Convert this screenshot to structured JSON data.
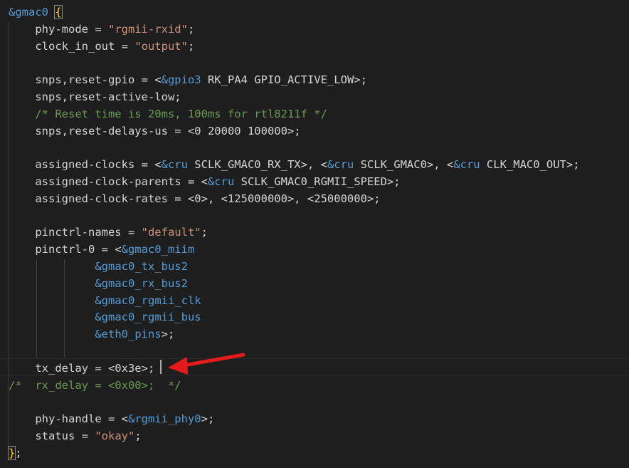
{
  "code": {
    "lines": [
      [
        {
          "t": "&gmac0",
          "c": "ref"
        },
        {
          "t": " ",
          "c": "plain"
        },
        {
          "t": "{",
          "c": "brace"
        }
      ],
      [
        {
          "t": "    phy-mode = ",
          "c": "plain"
        },
        {
          "t": "\"rgmii-rxid\"",
          "c": "str"
        },
        {
          "t": ";",
          "c": "plain"
        }
      ],
      [
        {
          "t": "    clock_in_out = ",
          "c": "plain"
        },
        {
          "t": "\"output\"",
          "c": "str"
        },
        {
          "t": ";",
          "c": "plain"
        }
      ],
      [],
      [
        {
          "t": "    snps,reset-gpio = <",
          "c": "plain"
        },
        {
          "t": "&gpio3",
          "c": "ref"
        },
        {
          "t": " RK_PA4 GPIO_ACTIVE_LOW>;",
          "c": "plain"
        }
      ],
      [
        {
          "t": "    snps,reset-active-low;",
          "c": "plain"
        }
      ],
      [
        {
          "t": "    /* Reset time is 20ms, 100ms for rtl8211f */",
          "c": "comment"
        }
      ],
      [
        {
          "t": "    snps,reset-delays-us = <0 20000 100000>;",
          "c": "plain"
        }
      ],
      [],
      [
        {
          "t": "    assigned-clocks = <",
          "c": "plain"
        },
        {
          "t": "&cru",
          "c": "ref"
        },
        {
          "t": " SCLK_GMAC0_RX_TX>, <",
          "c": "plain"
        },
        {
          "t": "&cru",
          "c": "ref"
        },
        {
          "t": " SCLK_GMAC0>, <",
          "c": "plain"
        },
        {
          "t": "&cru",
          "c": "ref"
        },
        {
          "t": " CLK_MAC0_OUT>;",
          "c": "plain"
        }
      ],
      [
        {
          "t": "    assigned-clock-parents = <",
          "c": "plain"
        },
        {
          "t": "&cru",
          "c": "ref"
        },
        {
          "t": " SCLK_GMAC0_RGMII_SPEED>;",
          "c": "plain"
        }
      ],
      [
        {
          "t": "    assigned-clock-rates = <0>, <125000000>, <25000000>;",
          "c": "plain"
        }
      ],
      [],
      [
        {
          "t": "    pinctrl-names = ",
          "c": "plain"
        },
        {
          "t": "\"default\"",
          "c": "str"
        },
        {
          "t": ";",
          "c": "plain"
        }
      ],
      [
        {
          "t": "    pinctrl-0 = <",
          "c": "plain"
        },
        {
          "t": "&gmac0_miim",
          "c": "ref"
        }
      ],
      [
        {
          "t": "             ",
          "c": "plain"
        },
        {
          "t": "&gmac0_tx_bus2",
          "c": "ref"
        }
      ],
      [
        {
          "t": "             ",
          "c": "plain"
        },
        {
          "t": "&gmac0_rx_bus2",
          "c": "ref"
        }
      ],
      [
        {
          "t": "             ",
          "c": "plain"
        },
        {
          "t": "&gmac0_rgmii_clk",
          "c": "ref"
        }
      ],
      [
        {
          "t": "             ",
          "c": "plain"
        },
        {
          "t": "&gmac0_rgmii_bus",
          "c": "ref"
        }
      ],
      [
        {
          "t": "             ",
          "c": "plain"
        },
        {
          "t": "&eth0_pins",
          "c": "ref"
        },
        {
          "t": ">;",
          "c": "plain"
        }
      ],
      [],
      [
        {
          "t": "    tx_delay = <0x3e>;",
          "c": "plain"
        }
      ],
      [
        {
          "t": "/*  rx_delay = <0x00>;  */",
          "c": "comment"
        }
      ],
      [],
      [
        {
          "t": "    phy-handle = <",
          "c": "plain"
        },
        {
          "t": "&rgmii_phy0",
          "c": "ref"
        },
        {
          "t": ">;",
          "c": "plain"
        }
      ],
      [
        {
          "t": "    status = ",
          "c": "plain"
        },
        {
          "t": "\"okay\"",
          "c": "str"
        },
        {
          "t": ";",
          "c": "plain"
        }
      ],
      [
        {
          "t": "}",
          "c": "brace"
        },
        {
          "t": ";",
          "c": "plain"
        }
      ]
    ],
    "cursor_line": 22,
    "annotation_icon": "red-arrow-icon",
    "colors": {
      "background": "#1e1e1e",
      "plain": "#d4d4d4",
      "reference": "#569cd6",
      "string": "#ce9178",
      "brace": "#ffd700",
      "comment": "#6a9955",
      "arrow": "#e51b1b"
    }
  }
}
